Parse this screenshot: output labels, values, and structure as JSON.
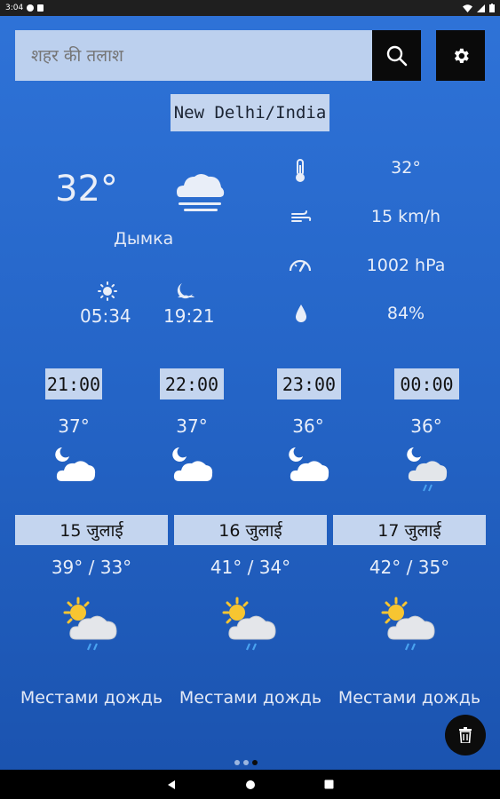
{
  "status_bar": {
    "time": "3:04"
  },
  "search": {
    "placeholder": "शहर की तलाश"
  },
  "location": {
    "label": "New Delhi/India"
  },
  "current": {
    "temp": "32°",
    "condition": "Дымка",
    "sunrise": "05:34",
    "sunset": "19:21",
    "icon": "fog-cloud-icon"
  },
  "details": {
    "feels_like": "32°",
    "wind": "15 km/h",
    "pressure": "1002 hPa",
    "humidity": "84%"
  },
  "hourly": [
    {
      "time": "21:00",
      "temp": "37°",
      "icon": "night-cloud-icon"
    },
    {
      "time": "22:00",
      "temp": "37°",
      "icon": "night-cloud-icon"
    },
    {
      "time": "23:00",
      "temp": "36°",
      "icon": "night-cloud-icon"
    },
    {
      "time": "00:00",
      "temp": "36°",
      "icon": "night-rain-icon"
    }
  ],
  "daily": [
    {
      "date": "15 जुलाई",
      "range": "39° / 33°",
      "condition": "Местами дождь",
      "icon": "sun-cloud-rain-icon"
    },
    {
      "date": "16 जुलाई",
      "range": "41° / 34°",
      "condition": "Местами дождь",
      "icon": "sun-cloud-rain-icon"
    },
    {
      "date": "17 जुलाई",
      "range": "42° / 35°",
      "condition": "Местами дождь",
      "icon": "sun-cloud-rain-icon"
    }
  ],
  "colors": {
    "background": "#2a6bd0",
    "panel": "#c4d5ef",
    "button": "#0a0a0a"
  }
}
